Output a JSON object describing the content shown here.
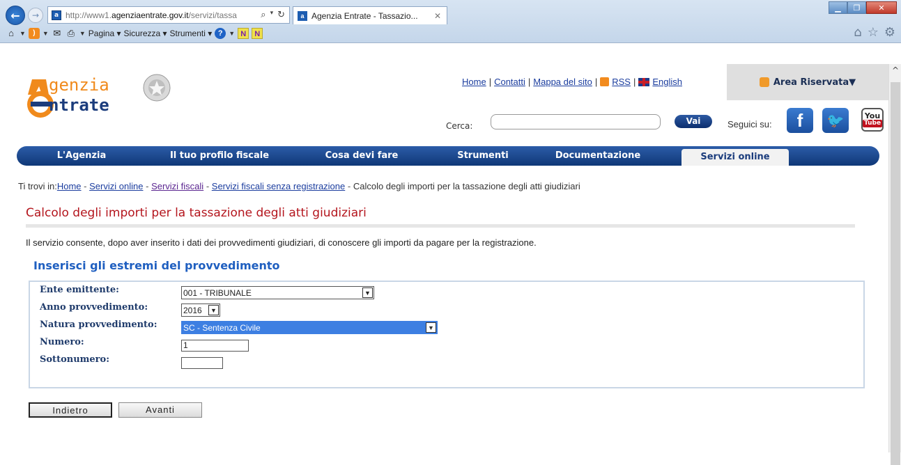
{
  "browser": {
    "url_prefix": "http://www1.",
    "url_domain": "agenziaentrate.gov.it",
    "url_path": "/servizi/tassa",
    "tab_title": "Agenzia Entrate - Tassazio...",
    "menu_pagina": "Pagina",
    "menu_sicurezza": "Sicurezza",
    "menu_strumenti": "Strumenti"
  },
  "header": {
    "logo_line1": "genzia",
    "logo_line2": "ntrate",
    "links": {
      "home": "Home",
      "contatti": "Contatti",
      "mappa": "Mappa del sito",
      "rss": "RSS",
      "english": "English"
    },
    "area_riservata": "Area Riservata▼",
    "cerca_label": "Cerca:",
    "cerca_value": "",
    "vai_label": "Vai",
    "seguici_label": "Seguici su:"
  },
  "nav": [
    {
      "label": "L'Agenzia"
    },
    {
      "label": "Il tuo profilo fiscale"
    },
    {
      "label": "Cosa devi fare"
    },
    {
      "label": "Strumenti"
    },
    {
      "label": "Documentazione"
    },
    {
      "label": "Servizi online"
    }
  ],
  "breadcrumb": {
    "prefix": "Ti trovi in:",
    "home": "Home",
    "servizi_online": "Servizi online",
    "servizi_fiscali": "Servizi fiscali",
    "senza_registrazione": "Servizi fiscali senza registrazione",
    "current": "Calcolo degli importi per la tassazione degli atti giudiziari"
  },
  "main": {
    "title": "Calcolo degli importi per la tassazione degli atti giudiziari",
    "intro": "Il servizio consente, dopo aver inserito i dati dei provvedimenti giudiziari, di conoscere gli importi da pagare per la registrazione.",
    "section_title": "Inserisci gli estremi del provvedimento"
  },
  "form": {
    "ente_label": "Ente emittente:",
    "ente_value": "001 - TRIBUNALE",
    "anno_label": "Anno provvedimento:",
    "anno_value": "2016",
    "natura_label": "Natura provvedimento:",
    "natura_value": "SC - Sentenza Civile",
    "numero_label": "Numero:",
    "numero_value": "1",
    "sottonumero_label": "Sottonumero:",
    "sottonumero_value": ""
  },
  "buttons": {
    "back": "Indietro",
    "next": "Avanti"
  },
  "colors": {
    "nav_blue": "#0f3877",
    "title_red": "#b4151d",
    "section_blue": "#1f5fc0"
  }
}
